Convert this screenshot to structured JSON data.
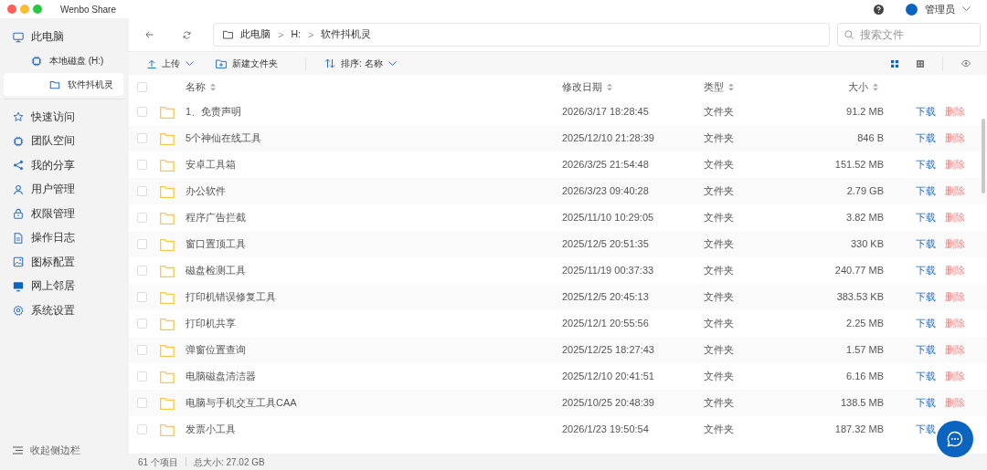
{
  "window": {
    "title": "Wenbo Share"
  },
  "account": {
    "user": "管理员"
  },
  "sidebar": {
    "tree": [
      {
        "label": "此电脑",
        "kind": "monitor",
        "selected": false,
        "children": [
          {
            "label": "本地磁盘 (H:)",
            "kind": "chip",
            "selected": false,
            "children": [
              {
                "label": "软件抖机灵",
                "kind": "folder",
                "selected": true
              }
            ]
          }
        ]
      }
    ],
    "items": [
      {
        "label": "快速访问",
        "kind": "star",
        "selected": false
      },
      {
        "label": "团队空间",
        "kind": "chip",
        "selected": false
      },
      {
        "label": "我的分享",
        "kind": "share",
        "selected": false
      },
      {
        "label": "用户管理",
        "kind": "user",
        "selected": false
      },
      {
        "label": "权限管理",
        "kind": "lock",
        "selected": false
      },
      {
        "label": "操作日志",
        "kind": "doc",
        "selected": false
      },
      {
        "label": "图标配置",
        "kind": "image",
        "selected": false
      },
      {
        "label": "网上邻居",
        "kind": "screen",
        "selected": false
      },
      {
        "label": "系统设置",
        "kind": "gear",
        "selected": false
      }
    ],
    "collapse": "收起侧边栏"
  },
  "breadcrumb": {
    "separator": ">",
    "parts": [
      "此电脑",
      "H:",
      "软件抖机灵"
    ]
  },
  "search": {
    "placeholder": "搜索文件"
  },
  "toolbar": {
    "upload": "上传",
    "new_folder": "新建文件夹",
    "sort": "排序: 名称",
    "view_modes": [
      {
        "kind": "large",
        "selected": true
      },
      {
        "kind": "small",
        "selected": false
      }
    ]
  },
  "table": {
    "select_all_checked": false,
    "columns": [
      "名称",
      "修改日期",
      "类型",
      "大小"
    ],
    "rows": [
      {
        "name": "1、免责声明",
        "modified": "2026/3/17 18:28:45",
        "type": "文件夹",
        "size": "91.2 MB",
        "checked": false,
        "actions": [
          {
            "label": "下载",
            "kind": "download"
          },
          {
            "label": "删除",
            "kind": "delete"
          }
        ]
      },
      {
        "name": "5个神仙在线工具",
        "modified": "2025/12/10 21:28:39",
        "type": "文件夹",
        "size": "846 B",
        "checked": false,
        "actions": [
          {
            "label": "下载",
            "kind": "download"
          },
          {
            "label": "删除",
            "kind": "delete"
          }
        ]
      },
      {
        "name": "安卓工具箱",
        "modified": "2026/3/25 21:54:48",
        "type": "文件夹",
        "size": "151.52 MB",
        "checked": false,
        "actions": [
          {
            "label": "下载",
            "kind": "download"
          },
          {
            "label": "删除",
            "kind": "delete"
          }
        ]
      },
      {
        "name": "办公软件",
        "modified": "2026/3/23 09:40:28",
        "type": "文件夹",
        "size": "2.79 GB",
        "checked": false,
        "actions": [
          {
            "label": "下载",
            "kind": "download"
          },
          {
            "label": "删除",
            "kind": "delete"
          }
        ]
      },
      {
        "name": "程序广告拦截",
        "modified": "2025/11/10 10:29:05",
        "type": "文件夹",
        "size": "3.82 MB",
        "checked": false,
        "actions": [
          {
            "label": "下载",
            "kind": "download"
          },
          {
            "label": "删除",
            "kind": "delete"
          }
        ]
      },
      {
        "name": "窗口置顶工具",
        "modified": "2025/12/5 20:51:35",
        "type": "文件夹",
        "size": "330 KB",
        "checked": false,
        "actions": [
          {
            "label": "下载",
            "kind": "download"
          },
          {
            "label": "删除",
            "kind": "delete"
          }
        ]
      },
      {
        "name": "磁盘检测工具",
        "modified": "2025/11/19 00:37:33",
        "type": "文件夹",
        "size": "240.77 MB",
        "checked": false,
        "actions": [
          {
            "label": "下载",
            "kind": "download"
          },
          {
            "label": "删除",
            "kind": "delete"
          }
        ]
      },
      {
        "name": "打印机错误修复工具",
        "modified": "2025/12/5 20:45:13",
        "type": "文件夹",
        "size": "383.53 KB",
        "checked": false,
        "actions": [
          {
            "label": "下载",
            "kind": "download"
          },
          {
            "label": "删除",
            "kind": "delete"
          }
        ]
      },
      {
        "name": "打印机共享",
        "modified": "2025/12/1 20:55:56",
        "type": "文件夹",
        "size": "2.25 MB",
        "checked": false,
        "actions": [
          {
            "label": "下载",
            "kind": "download"
          },
          {
            "label": "删除",
            "kind": "delete"
          }
        ]
      },
      {
        "name": "弹窗位置查询",
        "modified": "2025/12/25 18:27:43",
        "type": "文件夹",
        "size": "1.57 MB",
        "checked": false,
        "actions": [
          {
            "label": "下载",
            "kind": "download"
          },
          {
            "label": "删除",
            "kind": "delete"
          }
        ]
      },
      {
        "name": "电脑磁盘清洁器",
        "modified": "2025/12/10 20:41:51",
        "type": "文件夹",
        "size": "6.16 MB",
        "checked": false,
        "actions": [
          {
            "label": "下载",
            "kind": "download"
          },
          {
            "label": "删除",
            "kind": "delete"
          }
        ]
      },
      {
        "name": "电脑与手机交互工具CAA",
        "modified": "2025/10/25 20:48:39",
        "type": "文件夹",
        "size": "138.5 MB",
        "checked": false,
        "actions": [
          {
            "label": "下载",
            "kind": "download"
          },
          {
            "label": "删除",
            "kind": "delete"
          }
        ]
      },
      {
        "name": "发票小工具",
        "modified": "2026/1/23 19:50:54",
        "type": "文件夹",
        "size": "187.32 MB",
        "checked": false,
        "actions": [
          {
            "label": "下载",
            "kind": "download"
          }
        ]
      }
    ]
  },
  "status_bar": {
    "count": "61 个项目",
    "total": "总大小: 27.02 GB"
  }
}
